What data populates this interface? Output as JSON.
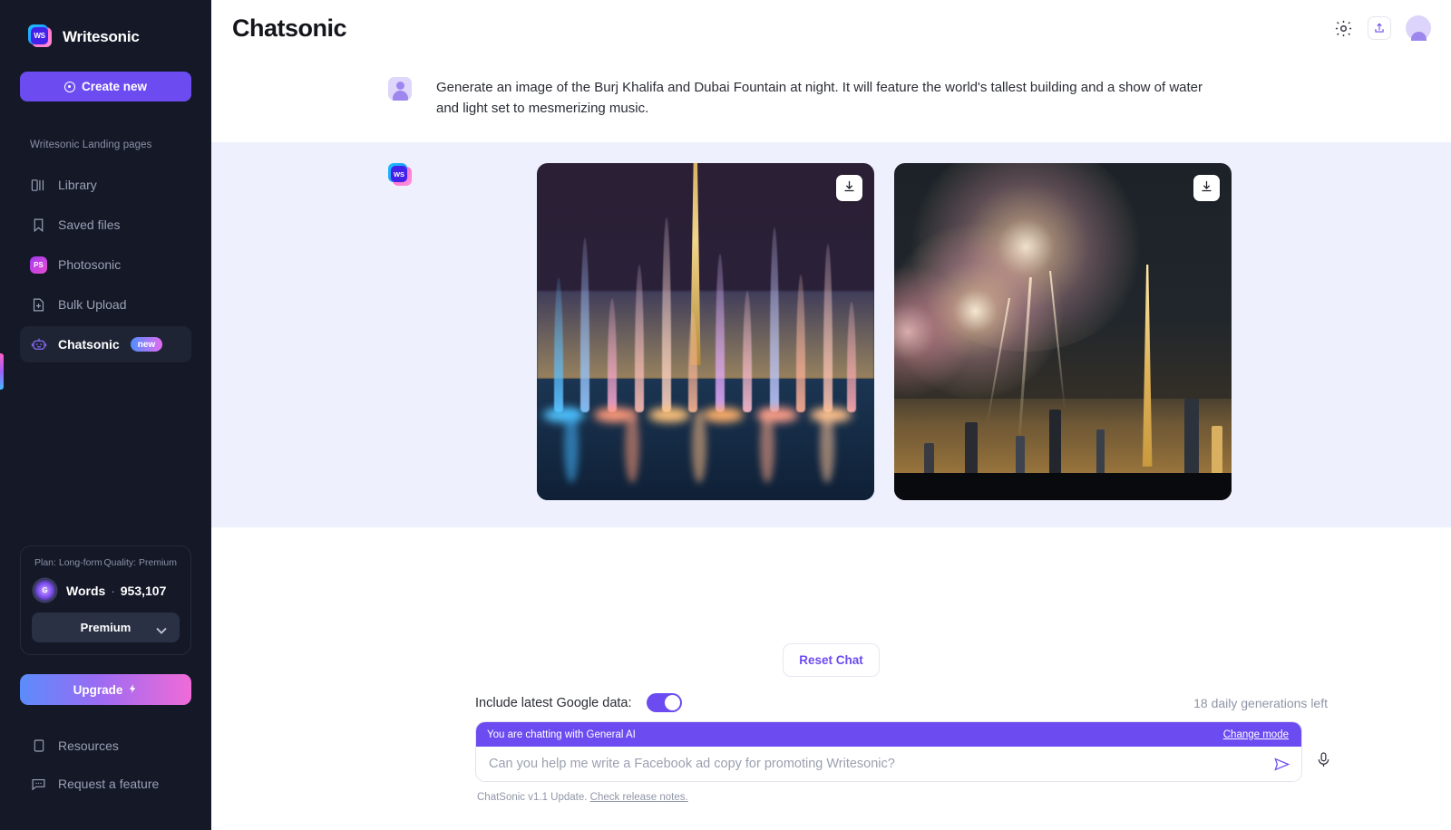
{
  "sidebar": {
    "brand": {
      "name": "Writesonic",
      "logo_text": "WS"
    },
    "create_new": {
      "label": "Create new",
      "icon": "plus-circle-icon"
    },
    "section_label": "Writesonic Landing pages",
    "items": [
      {
        "label": "Library",
        "icon": "library-icon",
        "active": false
      },
      {
        "label": "Saved files",
        "icon": "bookmark-icon",
        "active": false
      },
      {
        "label": "Photosonic",
        "icon": "photosonic-icon",
        "active": false
      },
      {
        "label": "Bulk Upload",
        "icon": "file-plus-icon",
        "active": false
      },
      {
        "label": "Chatsonic",
        "icon": "robot-icon",
        "active": true,
        "badge": "new"
      }
    ],
    "plan_card": {
      "plan": "Plan: Long-form",
      "quality": "Quality: Premium",
      "words_label": "Words",
      "words_separator": "·",
      "words_value": "953,107",
      "quality_select": "Premium",
      "orb_text": "G"
    },
    "upgrade": {
      "label": "Upgrade",
      "icon": "lightning-icon"
    },
    "bottom_items": [
      {
        "label": "Resources",
        "icon": "book-icon"
      },
      {
        "label": "Request a feature",
        "icon": "message-icon"
      }
    ]
  },
  "header": {
    "title": "Chatsonic",
    "actions": [
      {
        "name": "settings",
        "icon": "gear-icon"
      },
      {
        "name": "share",
        "icon": "share-icon"
      },
      {
        "name": "profile",
        "icon": "avatar-icon"
      }
    ]
  },
  "conversation": {
    "user_message": {
      "avatar": "user-avatar-icon",
      "text": "Generate an image of the Burj Khalifa and Dubai Fountain at night. It will feature the world's tallest building and a show of water and light set to mesmerizing music."
    },
    "bot_message": {
      "avatar": "writesonic-logo-icon",
      "logo_text": "WS",
      "images": [
        {
          "alt": "Dubai Fountain with Burj Khalifa at night",
          "download_icon": "download-icon"
        },
        {
          "alt": "Fireworks over Burj Khalifa skyline",
          "download_icon": "download-icon"
        }
      ]
    }
  },
  "composer": {
    "reset_chat": "Reset Chat",
    "google_toggle_label": "Include latest Google data:",
    "google_toggle_on": true,
    "generations_left": "18 daily generations left",
    "mode_text": "You are chatting with General AI",
    "change_mode": "Change mode",
    "input_placeholder": "Can you help me write a Facebook ad copy for promoting Writesonic?",
    "input_value": "",
    "send_icon": "send-icon",
    "mic_icon": "microphone-icon",
    "release_prefix": "ChatSonic v1.1 Update.",
    "release_link": "Check release notes."
  },
  "colors": {
    "sidebar_bg": "#141827",
    "accent": "#6c4cf1",
    "bot_bubble_bg": "#eef1fd",
    "badge_gradient_from": "#4f8dff",
    "badge_gradient_to": "#e46bf0"
  }
}
